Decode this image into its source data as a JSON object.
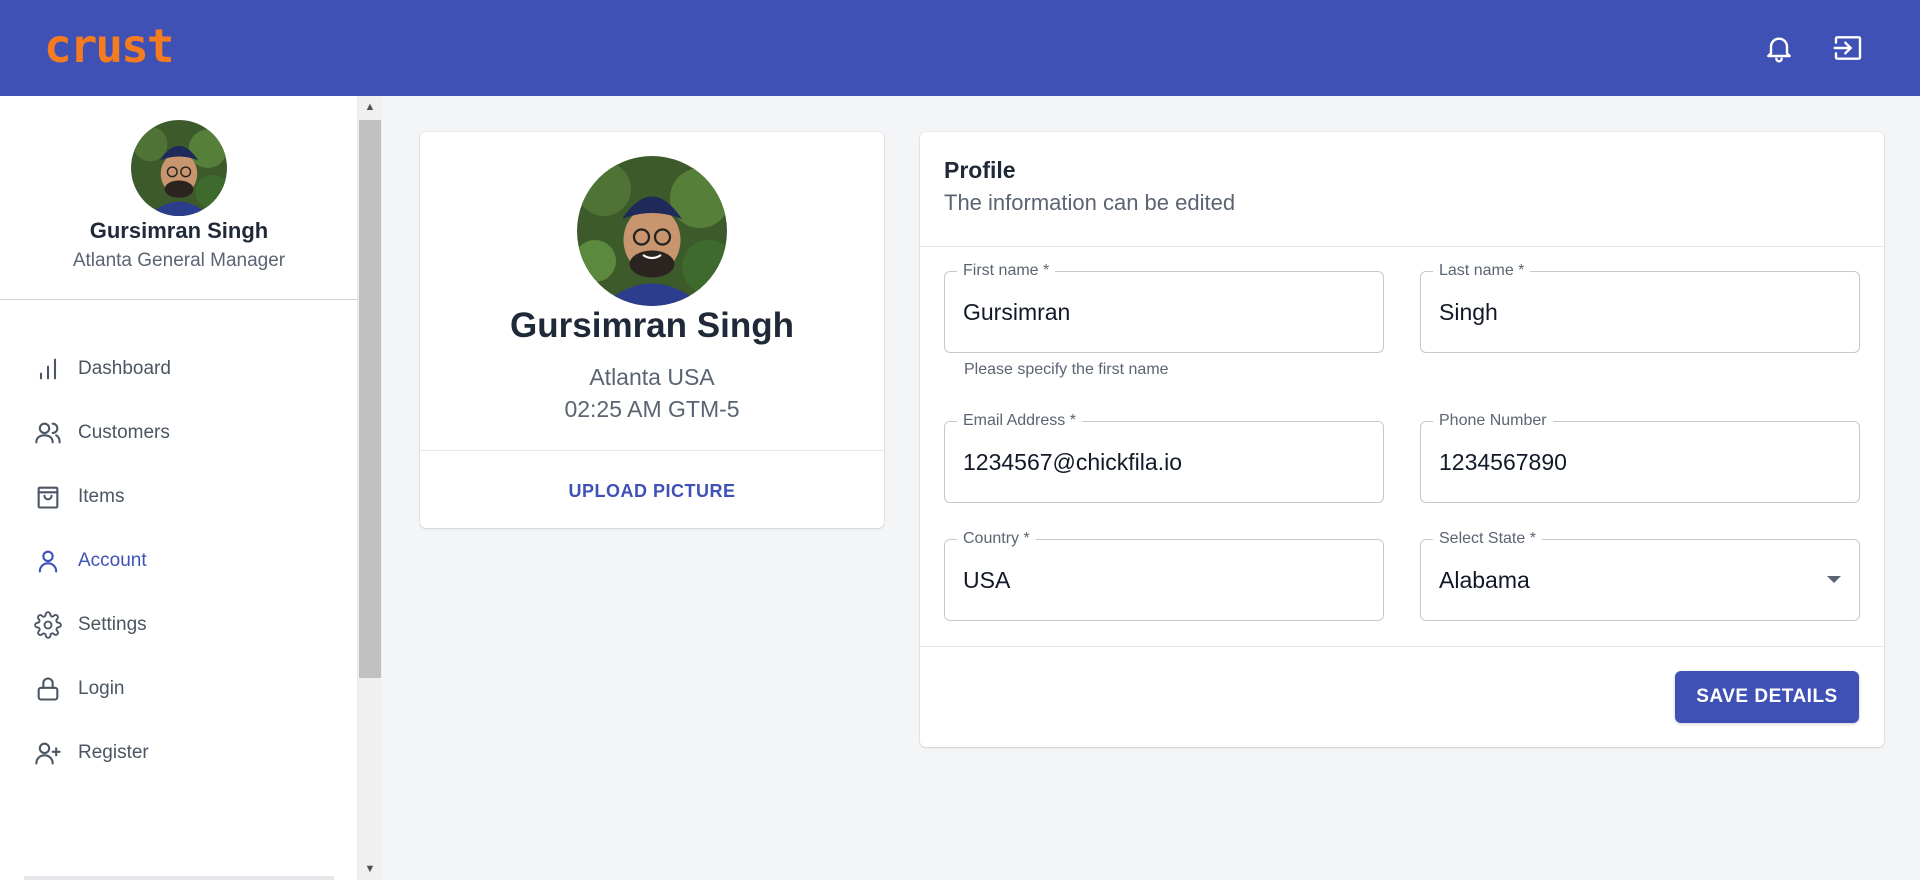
{
  "app": {
    "logo": "crust"
  },
  "topbar": {
    "icons": [
      "bell-icon",
      "logout-icon"
    ]
  },
  "sidebar": {
    "user": {
      "name": "Gursimran Singh",
      "role": "Atlanta General Manager"
    },
    "items": [
      {
        "label": "Dashboard",
        "icon": "bar-chart-icon",
        "active": false
      },
      {
        "label": "Customers",
        "icon": "users-icon",
        "active": false
      },
      {
        "label": "Items",
        "icon": "shopping-bag-icon",
        "active": false
      },
      {
        "label": "Account",
        "icon": "user-icon",
        "active": true
      },
      {
        "label": "Settings",
        "icon": "gear-icon",
        "active": false
      },
      {
        "label": "Login",
        "icon": "lock-icon",
        "active": false
      },
      {
        "label": "Register",
        "icon": "user-add-icon",
        "active": false
      }
    ]
  },
  "profile_card": {
    "name": "Gursimran Singh",
    "location": "Atlanta USA",
    "time": "02:25 AM GTM-5",
    "upload_label": "UPLOAD PICTURE"
  },
  "form": {
    "title": "Profile",
    "subtitle": "The information can be edited",
    "first_name": {
      "label": "First name *",
      "value": "Gursimran",
      "helper": "Please specify the first name"
    },
    "last_name": {
      "label": "Last name *",
      "value": "Singh"
    },
    "email": {
      "label": "Email Address *",
      "value": "1234567@chickfila.io"
    },
    "phone": {
      "label": "Phone Number",
      "value": "1234567890"
    },
    "country": {
      "label": "Country *",
      "value": "USA"
    },
    "state": {
      "label": "Select State *",
      "value": "Alabama"
    },
    "save_label": "SAVE DETAILS"
  },
  "colors": {
    "primary": "#3f51b5",
    "logo": "#f47b20",
    "background": "#f4f5f7"
  }
}
